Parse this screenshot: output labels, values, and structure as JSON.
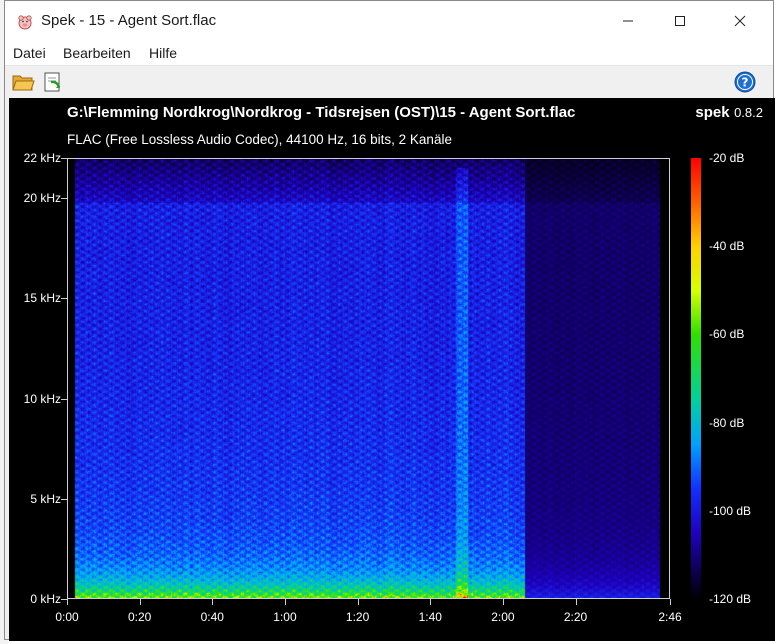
{
  "window": {
    "title": "Spek - 15 - Agent Sort.flac"
  },
  "menu": [
    {
      "id": "datei",
      "label": "Datei"
    },
    {
      "id": "bearbeiten",
      "label": "Bearbeiten"
    },
    {
      "id": "hilfe",
      "label": "Hilfe"
    }
  ],
  "toolbar": {
    "open_icon": "folder-open-icon",
    "save_icon": "save-icon",
    "help_icon": "help-icon"
  },
  "spectrum": {
    "file_path": "G:\\Flemming Nordkrog\\Nordkrog - Tidsrejsen (OST)\\15 - Agent Sort.flac",
    "codec_info": "FLAC (Free Lossless Audio Codec), 44100 Hz, 16 bits, 2 Kanäle",
    "brand_name": "spek",
    "brand_version": "0.8.2",
    "y_axis": {
      "unit": "Hz",
      "min": 0,
      "max": 22000,
      "ticks": [
        {
          "value": 22000,
          "label": "22 kHz"
        },
        {
          "value": 20000,
          "label": "20 kHz"
        },
        {
          "value": 15000,
          "label": "15 kHz"
        },
        {
          "value": 10000,
          "label": "10 kHz"
        },
        {
          "value": 5000,
          "label": "5 kHz"
        },
        {
          "value": 0,
          "label": "0 kHz"
        }
      ]
    },
    "x_axis": {
      "unit": "s",
      "min": 0,
      "max": 166,
      "ticks": [
        {
          "value": 0,
          "label": "0:00"
        },
        {
          "value": 20,
          "label": "0:20"
        },
        {
          "value": 40,
          "label": "0:40"
        },
        {
          "value": 60,
          "label": "1:00"
        },
        {
          "value": 80,
          "label": "1:20"
        },
        {
          "value": 100,
          "label": "1:40"
        },
        {
          "value": 120,
          "label": "2:00"
        },
        {
          "value": 140,
          "label": "2:20"
        },
        {
          "value": 166,
          "label": "2:46"
        }
      ]
    },
    "colorbar": {
      "unit": "dB",
      "min": -120,
      "max": -20,
      "ticks": [
        {
          "value": -20,
          "label": "-20 dB"
        },
        {
          "value": -40,
          "label": "-40 dB"
        },
        {
          "value": -60,
          "label": "-60 dB"
        },
        {
          "value": -80,
          "label": "-80 dB"
        },
        {
          "value": -100,
          "label": "-100 dB"
        },
        {
          "value": -120,
          "label": "-120 dB"
        }
      ]
    }
  }
}
